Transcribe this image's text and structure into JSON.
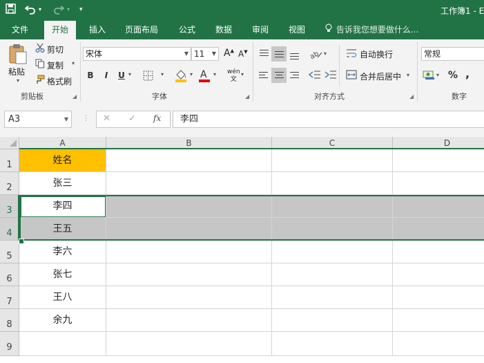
{
  "window": {
    "title": "工作簿1 - E"
  },
  "quick_access": {
    "save_icon": "save-icon",
    "undo_icon": "undo-icon",
    "redo_icon": "redo-icon",
    "customize": "▾"
  },
  "tabs": [
    {
      "label": "文件"
    },
    {
      "label": "开始",
      "active": true
    },
    {
      "label": "插入"
    },
    {
      "label": "页面布局"
    },
    {
      "label": "公式"
    },
    {
      "label": "数据"
    },
    {
      "label": "审阅"
    },
    {
      "label": "视图"
    }
  ],
  "tell_me": {
    "placeholder": "告诉我您想要做什么..."
  },
  "ribbon": {
    "clipboard": {
      "group_label": "剪贴板",
      "paste": "粘贴",
      "cut": "剪切",
      "copy": "复制",
      "format_painter": "格式刷"
    },
    "font": {
      "group_label": "字体",
      "font_name": "宋体",
      "font_size": "11",
      "grow": "A",
      "shrink": "A",
      "bold": "B",
      "italic": "I",
      "underline": "U",
      "phonetic": "wén",
      "phonetic_sub": "文"
    },
    "alignment": {
      "group_label": "对齐方式",
      "wrap_text": "自动换行",
      "merge_center": "合并后居中"
    },
    "number": {
      "group_label": "数字",
      "format": "常规",
      "percent": "%",
      "comma": ","
    }
  },
  "formula_bar": {
    "name_box": "A3",
    "fx": "fx",
    "cancel": "✕",
    "enter": "✓",
    "content": "李四"
  },
  "sheet": {
    "columns": [
      "A",
      "B",
      "C",
      "D"
    ],
    "rows": [
      {
        "num": "1",
        "a": "姓名"
      },
      {
        "num": "2",
        "a": "张三"
      },
      {
        "num": "3",
        "a": "李四"
      },
      {
        "num": "4",
        "a": "王五"
      },
      {
        "num": "5",
        "a": "李六"
      },
      {
        "num": "6",
        "a": "张七"
      },
      {
        "num": "7",
        "a": "王八"
      },
      {
        "num": "8",
        "a": "余九"
      },
      {
        "num": "9",
        "a": ""
      }
    ],
    "header_fill": "#ffc000",
    "selection_color": "#217346"
  }
}
